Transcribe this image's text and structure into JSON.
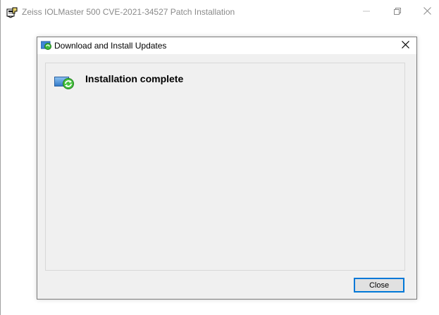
{
  "outer_window": {
    "title": "Zeiss IOLMaster 500 CVE-2021-34527 Patch Installation",
    "app_icon": "installer-icon",
    "controls": {
      "minimize_icon": "minimize-icon",
      "maximize_icon": "restore-icon",
      "close_icon": "close-icon"
    }
  },
  "dialog": {
    "title": "Download and Install Updates",
    "title_icon": "windows-update-icon",
    "close_icon": "close-icon",
    "status_icon": "windows-update-icon",
    "status_text": "Installation complete",
    "close_button_label": "Close"
  },
  "colors": {
    "accent": "#0078d7",
    "dialog_background": "#f0f0f0",
    "button_face": "#e1e1e1"
  }
}
